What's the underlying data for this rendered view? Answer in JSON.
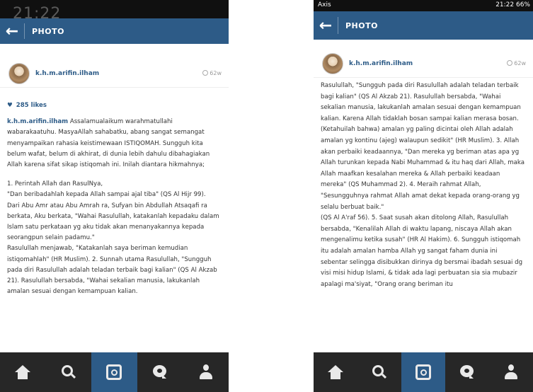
{
  "left_screen": {
    "status": {
      "time_ghost": "21:22"
    },
    "header": {
      "title": "PHOTO"
    },
    "post": {
      "username": "k.h.m.arifin.ilham",
      "time_ago": "62w",
      "likes": "285 likes",
      "caption_user": "k.h.m.arifin.ilham",
      "paragraphs": [
        "Assalamualaikum warahmatullahi wabarakaatuhu. MasyaAllah sahabatku, abang sangat semangat menyampaikan rahasia keistimewaan ISTIQOMAH. Sungguh kita belum wafat, belum di akhirat, di dunia lebih dahulu dibahagiakan Allah karena sifat sikap istiqomah ini. Inilah diantara hikmahnya;",
        "",
        "1. Perintah Allah dan RasulNya,",
        "\"Dan beribadahlah kepada Allah sampai ajal tiba\" (QS Al Hijr 99). Dari Abu Amr atau Abu Amrah ra, Sufyan bin Abdullah Atsaqafi ra berkata, Aku berkata, \"Wahai Rasulullah, katakanlah kepadaku dalam Islam satu perkataan yg aku tidak akan menanyakannya kepada seorangpun selain padamu.\"",
        "Rasulullah menjawab, \"Katakanlah saya beriman kemudian istiqomahlah\" (HR Muslim). 2. Sunnah utama Rasulullah, \"Sungguh pada diri Rasulullah adalah teladan terbaik bagi kalian\" (QS Al Akzab 21). Rasulullah bersabda, \"Wahai sekalian manusia, lakukanlah amalan sesuai dengan kemampuan kalian."
      ]
    },
    "nav": [
      "home-icon",
      "search-icon",
      "camera-icon",
      "news-icon",
      "profile-icon"
    ]
  },
  "right_screen": {
    "status": {
      "left": "Axis",
      "right": "21:22 66%"
    },
    "header": {
      "title": "PHOTO"
    },
    "post": {
      "username": "k.h.m.arifin.ilham",
      "time_ago": "62w",
      "paragraphs": [
        "Rasulullah, \"Sungguh pada diri Rasulullah adalah teladan terbaik bagi kalian\" (QS Al Akzab 21). Rasulullah bersabda, \"Wahai sekalian manusia, lakukanlah amalan sesuai dengan kemampuan kalian. Karena Allah tidaklah bosan sampai kalian merasa bosan. (Ketahuilah bahwa) amalan yg paling dicintai oleh Allah adalah amalan yg kontinu (ajeg) walaupun sedikit\" (HR Muslim). 3. Allah akan perbaiki keadaannya, \"Dan mereka yg beriman atas apa yg Allah turunkan kepada Nabi Muhammad & itu haq dari Allah, maka Allah maafkan kesalahan mereka & Allah perbaiki keadaan mereka\" (QS Muhammad 2). 4. Meraih rahmat Allah, \"Sesungguhnya rahmat Allah amat dekat kepada orang-orang yg selalu berbuat baik.\"",
        "(QS Al A'raf 56). 5. Saat susah akan ditolong Allah, Rasulullah bersabda, \"Kenalilah Allah di waktu lapang, niscaya Allah akan mengenalimu ketika susah\" (HR Al Hakim). 6. Sungguh istiqomah itu adalah amalan hamba Allah yg sangat faham dunia ini sebentar selingga disibukkan dirinya dg bersmai ibadah sesuai dg visi misi hidup Islami, & tidak ada lagi perbuatan sia sia mubazir apalagi ma'siyat, \"Orang orang beriman itu"
      ]
    },
    "nav": [
      "home-icon",
      "search-icon",
      "camera-icon",
      "news-icon",
      "profile-icon"
    ]
  }
}
